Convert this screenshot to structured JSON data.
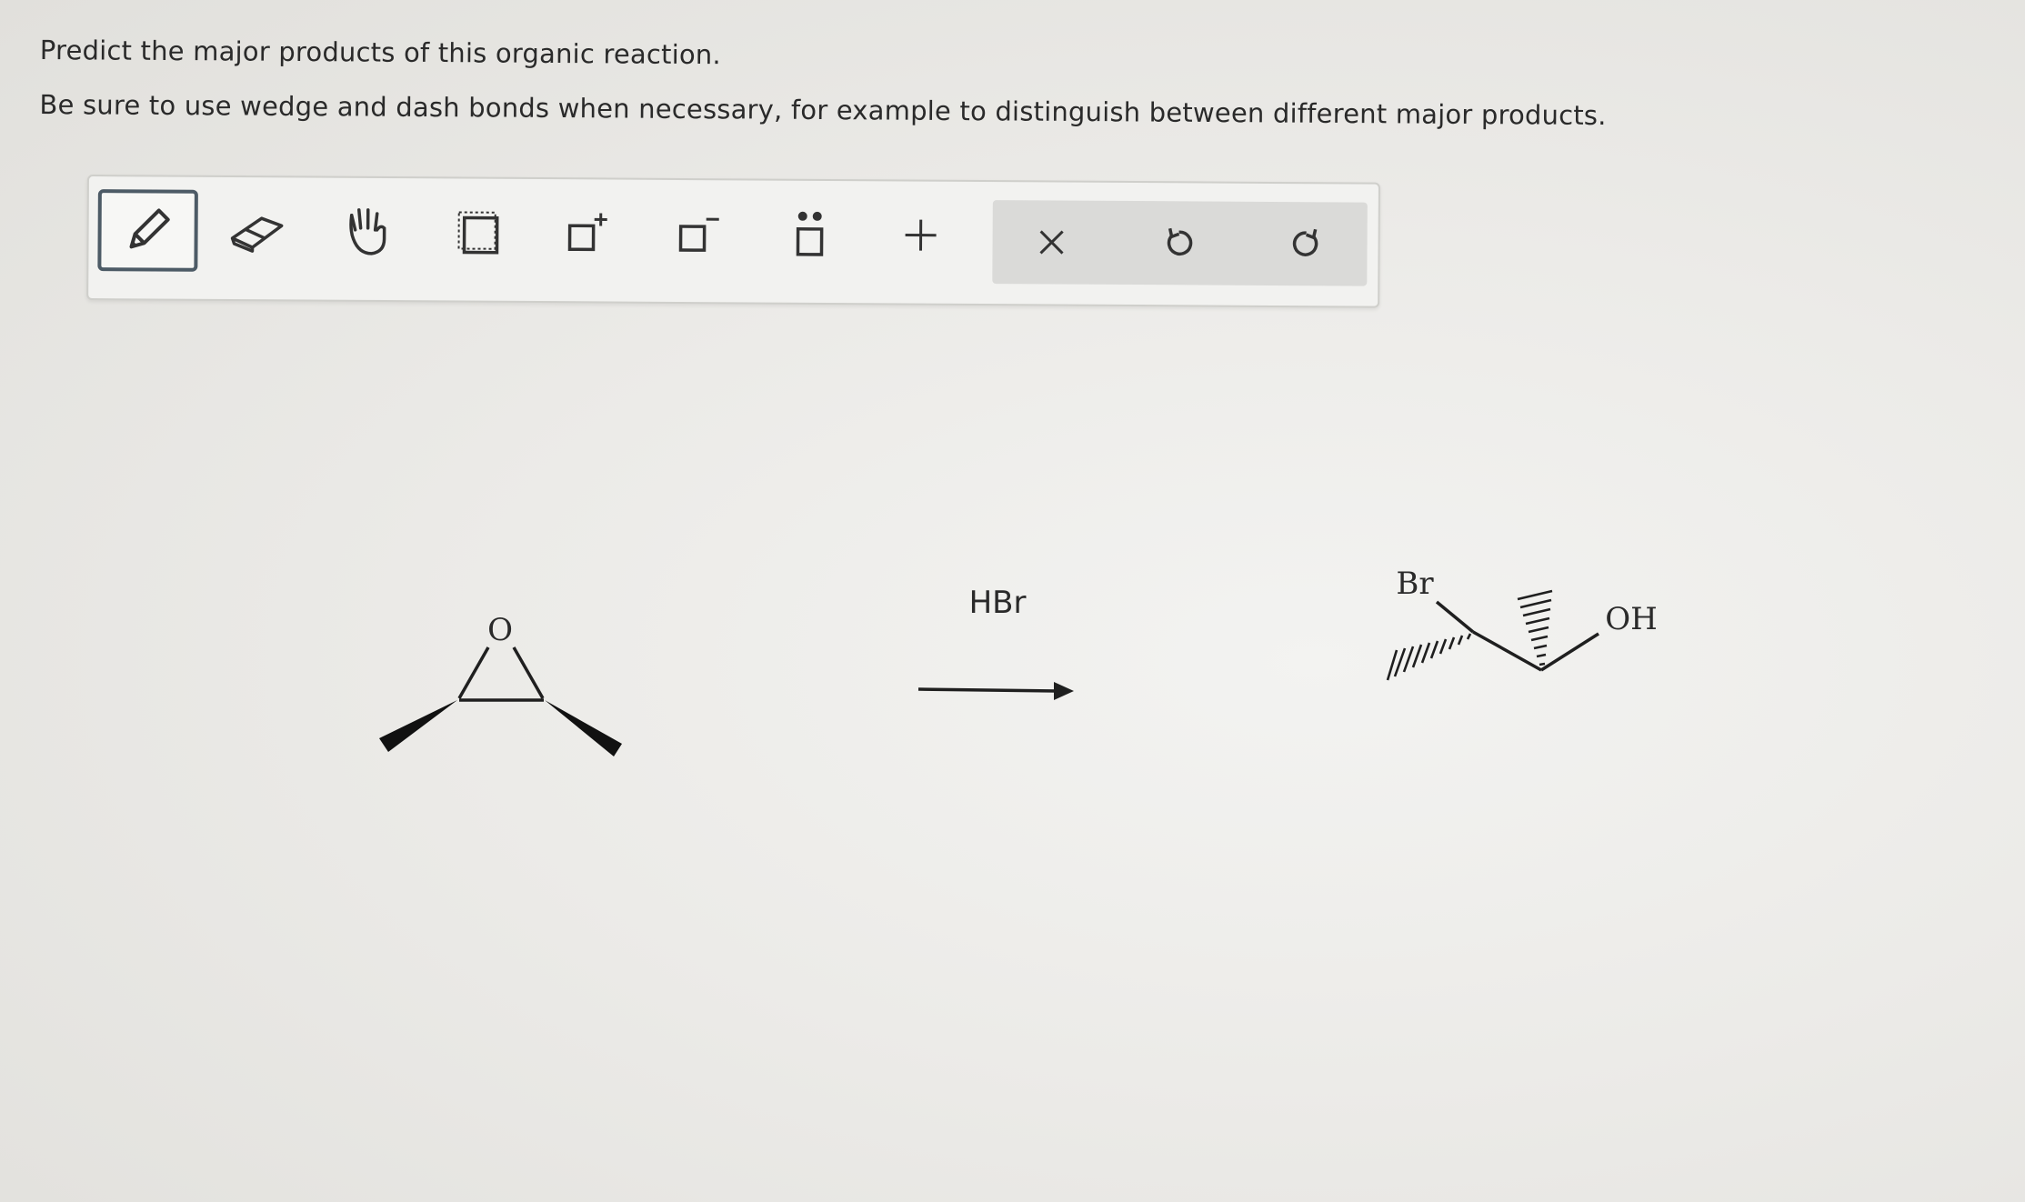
{
  "instructions": {
    "line1": "Predict the major products of this organic reaction.",
    "line2": "Be sure to use wedge and dash bonds when necessary, for example to distinguish between different major products."
  },
  "toolbar": {
    "tools": [
      {
        "name": "pencil",
        "icon": "pencil-icon",
        "active": true
      },
      {
        "name": "eraser",
        "icon": "eraser-icon",
        "active": false
      },
      {
        "name": "hand",
        "icon": "hand-icon",
        "active": false
      },
      {
        "name": "select",
        "icon": "select-box-icon",
        "active": false
      },
      {
        "name": "positive-charge",
        "icon": "positive-charge-icon",
        "active": false
      },
      {
        "name": "negative-charge",
        "icon": "negative-charge-icon",
        "active": false
      },
      {
        "name": "lone-pair",
        "icon": "lone-pair-icon",
        "active": false
      },
      {
        "name": "add-reaction",
        "icon": "plus-icon",
        "active": false
      }
    ],
    "actions": [
      {
        "name": "clear",
        "icon": "close-icon"
      },
      {
        "name": "undo",
        "icon": "undo-icon"
      },
      {
        "name": "redo",
        "icon": "redo-icon"
      }
    ]
  },
  "reaction": {
    "reactant_atom": "O",
    "reagent": "HBr",
    "product_labels": {
      "bromine": "Br",
      "hydroxyl": "OH"
    }
  },
  "colors": {
    "ink": "#1f1f1f",
    "toolbar_bg": "#f2f2f0",
    "action_bg": "#dadad8",
    "active_border": "#4d5b66"
  }
}
